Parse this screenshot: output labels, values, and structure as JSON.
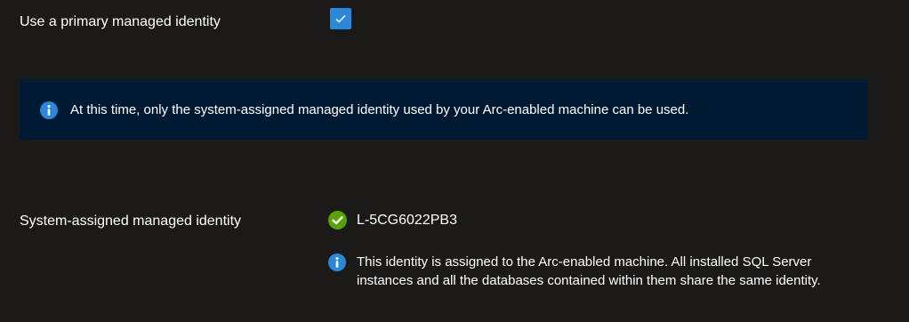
{
  "primary_identity": {
    "label": "Use a primary managed identity",
    "checked": true,
    "checkbox_color": "#2b88d8"
  },
  "info_banner": {
    "icon": "info-icon",
    "text": "At this time, only the system-assigned managed identity used by your Arc-enabled machine can be used.",
    "background": "#001a33"
  },
  "system_identity": {
    "label": "System-assigned managed identity",
    "status_icon": "check-circle-icon",
    "status_color": "#57a300",
    "value": "L-5CG6022PB3",
    "note_icon": "info-icon",
    "note": "This identity is assigned to the Arc-enabled machine. All installed SQL Server instances and all the databases contained within them share the same identity."
  }
}
